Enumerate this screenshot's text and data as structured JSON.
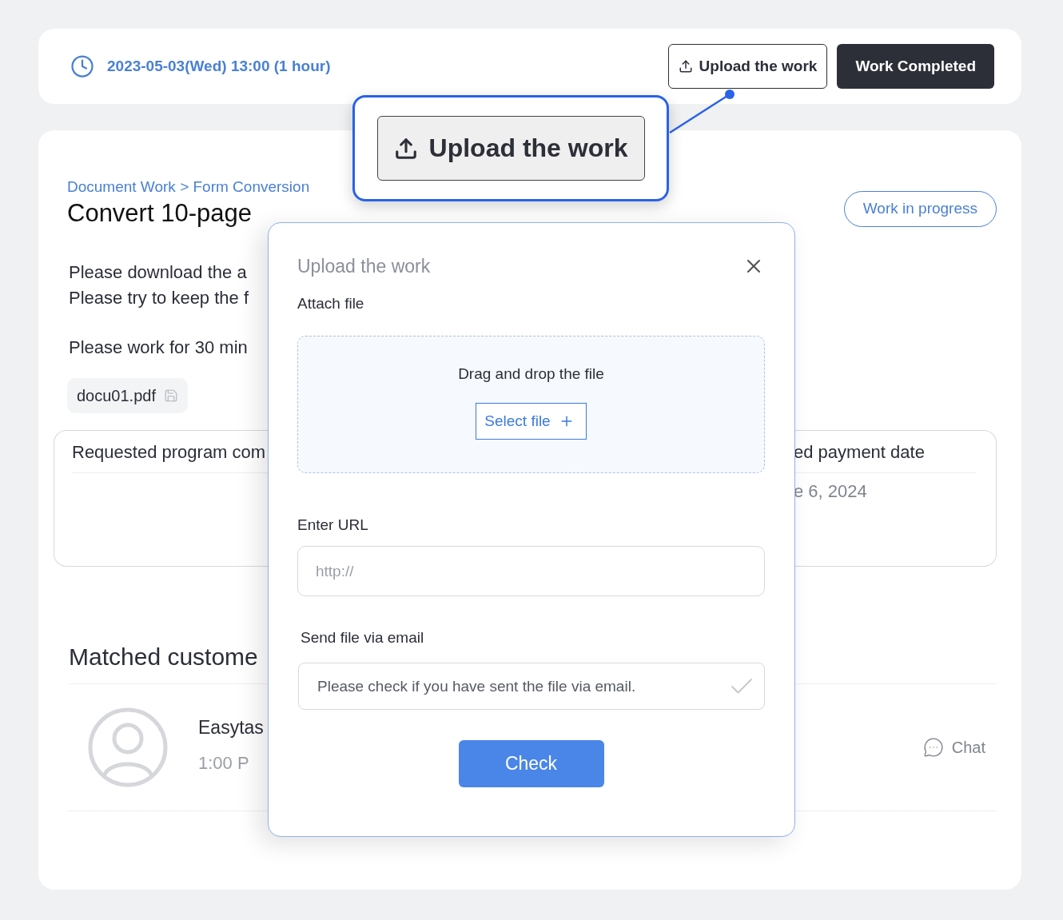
{
  "header": {
    "datetime": "2023-05-03(Wed) 13:00 (1 hour)",
    "buttons": [
      {
        "label": "Upload the work",
        "kind": "outline"
      },
      {
        "label": "Work Completed",
        "kind": "solid"
      }
    ]
  },
  "task": {
    "breadcrumb": "Document Work > Form Conversion",
    "title": "Convert 10-page",
    "status": "Work in progress",
    "description": [
      "Please download the a",
      "Please try to keep the f"
    ],
    "note": "Please work for 30 min",
    "attachment": "docu01.pdf"
  },
  "info_boxes": [
    {
      "heading": "Requested program com"
    },
    {
      "heading": "ed payment date",
      "value": "e 6, 2024"
    }
  ],
  "matched": {
    "heading": "Matched custome",
    "customers": [
      {
        "name": "Easytas",
        "time": "1:00 P",
        "action": "Chat"
      }
    ]
  },
  "callout": {
    "label": "Upload the work"
  },
  "modal": {
    "title": "Upload the work",
    "attach_label": "Attach file",
    "dropzone_text": "Drag and drop the file",
    "select_button": "Select file",
    "url_label": "Enter URL",
    "url_placeholder": "http://",
    "email_label": "Send file via email",
    "email_check": {
      "text": "Please check if you have sent the file via email.",
      "checked": false
    },
    "submit": "Check"
  }
}
